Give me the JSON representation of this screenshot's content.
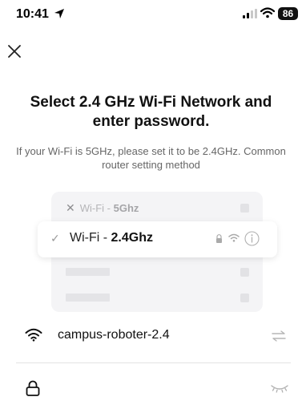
{
  "status_bar": {
    "time": "10:41",
    "battery": "86"
  },
  "title": "Select 2.4 GHz Wi-Fi Network and enter password.",
  "subtitle": "If your Wi-Fi is 5GHz, please set it to be 2.4GHz. Common router setting method",
  "illustration": {
    "row_5g": {
      "prefix": "Wi-Fi - ",
      "band": "5Ghz"
    },
    "row_24g": {
      "prefix": "Wi-Fi - ",
      "band": "2.4Ghz"
    }
  },
  "network": {
    "ssid": "campus-roboter-2.4"
  },
  "password": {
    "value": "",
    "placeholder": ""
  },
  "icons": {
    "close": "close-icon",
    "wifi": "wifi-icon",
    "lock": "lock-icon",
    "switch": "switch-network-icon",
    "eye": "eye-closed-icon",
    "info": "info-icon"
  },
  "colors": {
    "text_primary": "#111111",
    "text_secondary": "#666666",
    "illustration_bg": "#f4f4f6"
  }
}
